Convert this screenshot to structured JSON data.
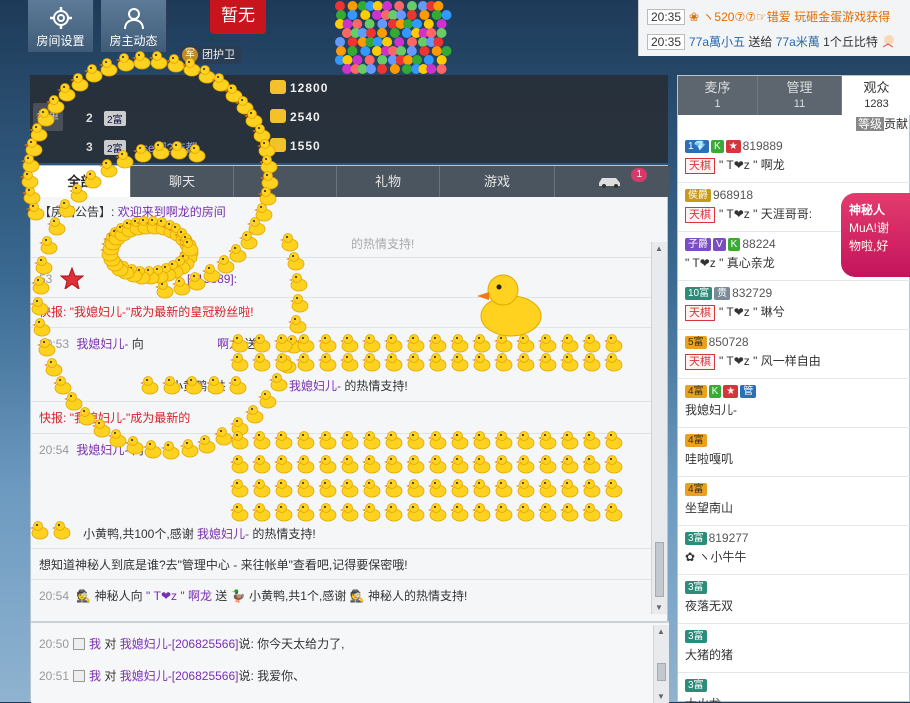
{
  "toolbar": {
    "room_settings": "房间设置",
    "host_updates": "房主动态",
    "status_badge": "暂无",
    "guard_tag": "军",
    "guard_label": "团护卫"
  },
  "broadcast": [
    {
      "time": "20:35",
      "prefix": "❀ ヽ520⑦⑦☞错爱",
      "text": "玩砸金蛋游戏获得"
    },
    {
      "time": "20:35",
      "user": "77a萬小五",
      "action": "送给",
      "target": "77a米萬",
      "gift": "1个丘比特"
    }
  ],
  "rank": {
    "tag": "榜单",
    "rows": [
      {
        "num": "",
        "level": "",
        "name": "",
        "value": "12800"
      },
      {
        "num": "2",
        "level": "2富",
        "name": "",
        "value": "2540"
      },
      {
        "num": "3",
        "level": "2富",
        "name": "se啊?咋都",
        "value": "1550"
      }
    ]
  },
  "chat_tabs": [
    {
      "label": "全部",
      "active": true
    },
    {
      "label": "聊天"
    },
    {
      "label": ""
    },
    {
      "label": "礼物"
    },
    {
      "label": "游戏"
    },
    {
      "label": "",
      "badge": "1",
      "icon": "car-icon"
    }
  ],
  "chat": {
    "notice_label": "【房间公告】:",
    "notice_text": "欢迎来到啊龙的房间",
    "line1_tail": "的热情支持!",
    "line2_time": "53",
    "line2_id": "[819889]:",
    "flash1_label": "快报:",
    "flash1_text": "\"我媳妇儿-\"成为最新的皇冠粉丝啦!",
    "line3_time": "20:53",
    "line3_user": "我媳妇儿-",
    "line3_action": "向",
    "line3_target": "啊龙",
    "line3_send": "送",
    "line4_gift": "小黄鸭,",
    "line4_mid": "共",
    "line4_user": "我媳妇儿-",
    "line4_tail": "的热情支持!",
    "flash2_label": "快报:",
    "flash2_text": "\"我媳妇儿-\"成为最新的",
    "line5_time": "20:54",
    "line5_user": "我媳妇儿-",
    "line5_action": "向",
    "line6_text": "小黄鸭,共100个,感谢",
    "line6_user": "我媳妇儿-",
    "line6_tail": "的热情支持!",
    "mystery_tip": "想知道神秘人到底是谁?去\"管理中心 - 来往帐单\"查看吧,记得要保密哦!",
    "line7_time": "20:54",
    "line7_user": "神秘人向",
    "line7_target": "\" T❤z \" 啊龙",
    "line7_send": "送",
    "line7_tail": "小黄鸭,共1个,感谢",
    "line7_user2": "神秘人的热情支持!"
  },
  "private_chat": [
    {
      "time": "20:50",
      "me": "我",
      "to": "对",
      "target": "我媳妇儿-[206825566]",
      "said": "说:",
      "text": "你今天太给力了,"
    },
    {
      "time": "20:51",
      "me": "我",
      "to": "对",
      "target": "我媳妇儿-[206825566]",
      "said": "说:",
      "text": "我爱你、"
    }
  ],
  "right_tabs": [
    {
      "label": "麦序",
      "count": "1"
    },
    {
      "label": "管理",
      "count": "11"
    },
    {
      "label": "观众",
      "count": "1283",
      "active": true
    }
  ],
  "sort": {
    "level": "等级",
    "contrib": "贡献"
  },
  "users": [
    {
      "badges": [
        "1💎",
        "K",
        "★"
      ],
      "id": "819889",
      "tag": "天棋",
      "name": "\" T❤z \" 啊龙"
    },
    {
      "badges": [
        "侯爵"
      ],
      "id": "968918",
      "tag": "天棋",
      "name": "\" T❤z \" 天涯哥哥:"
    },
    {
      "badges": [
        "子爵",
        "V",
        "K"
      ],
      "id": "88224",
      "tag": "",
      "name": "\" T❤z \" 真心亲龙"
    },
    {
      "badges": [
        "10富",
        "贵"
      ],
      "id": "832729",
      "tag": "天棋",
      "name": "\" T❤z \" 琳兮"
    },
    {
      "badges": [
        "5富"
      ],
      "id": "850728",
      "tag": "天棋",
      "name": "\" T❤z \" 风一样自由"
    },
    {
      "badges": [
        "4富",
        "K",
        "★",
        "管"
      ],
      "id": "",
      "tag": "",
      "name": "我媳妇儿-"
    },
    {
      "badges": [
        "4富"
      ],
      "id": "",
      "tag": "",
      "name": "哇啦嘎叽"
    },
    {
      "badges": [
        "4富"
      ],
      "id": "",
      "tag": "",
      "name": "坐望南山"
    },
    {
      "badges": [
        "3富"
      ],
      "id": "819277",
      "tag": "",
      "name": "✿ ヽ小牛牛"
    },
    {
      "badges": [
        "3富"
      ],
      "id": "",
      "tag": "",
      "name": "夜落无双"
    },
    {
      "badges": [
        "3富"
      ],
      "id": "",
      "tag": "",
      "name": "大猪的猪"
    },
    {
      "badges": [
        "3富"
      ],
      "id": "",
      "tag": "",
      "name": "大火龙"
    }
  ],
  "mystery_panel": {
    "title": "神秘人",
    "sub1": "MuA!谢",
    "sub2": "物啦,好"
  },
  "colors": {
    "accent": "#d8343c",
    "purple": "#7a2fb0",
    "tab_bg": "#4b5560"
  }
}
